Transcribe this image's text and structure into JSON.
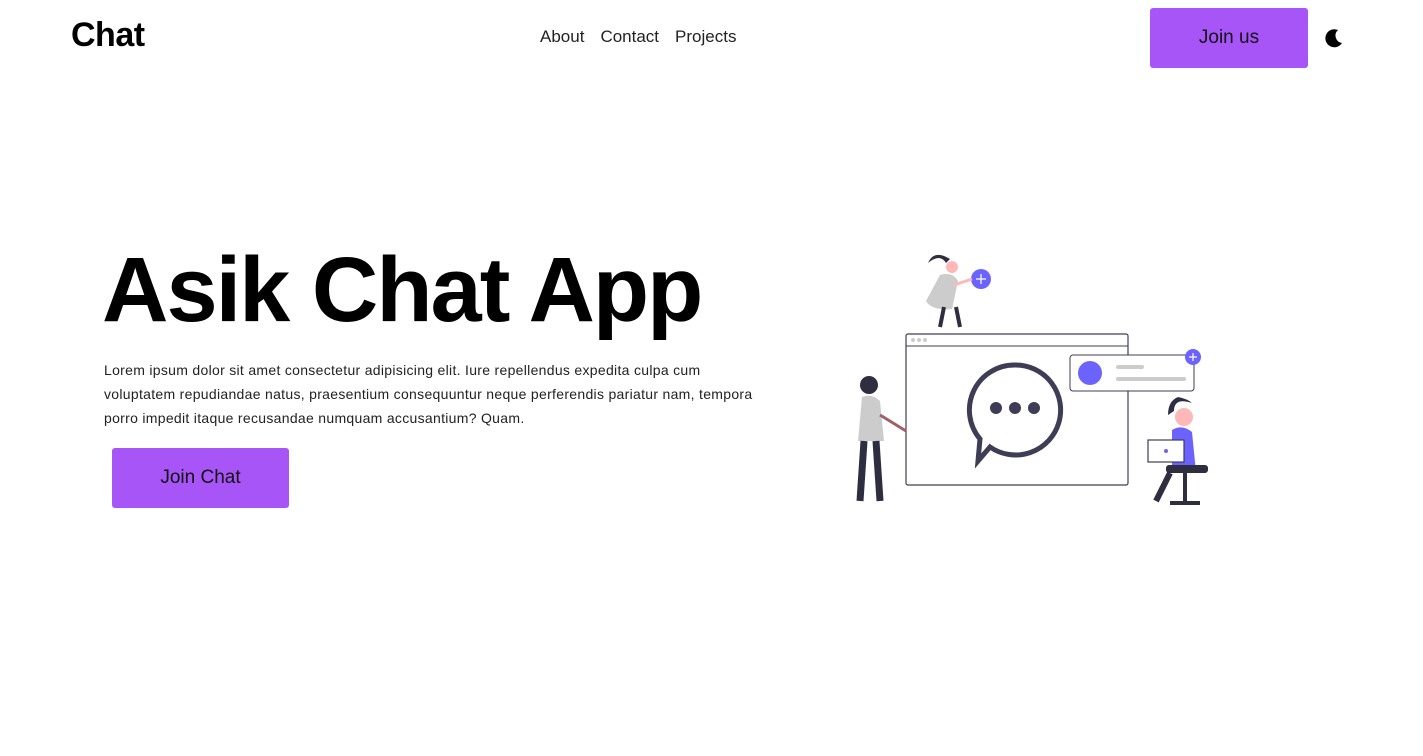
{
  "nav": {
    "logo": "Chat",
    "links": [
      "About",
      "Contact",
      "Projects"
    ],
    "join_label": "Join us",
    "theme_icon": "moon-icon"
  },
  "hero": {
    "title": "Asik Chat App",
    "description": "Lorem ipsum dolor sit amet consectetur adipisicing elit. Iure repellendus expedita culpa cum voluptatem repudiandae natus, praesentium consequuntur neque perferendis pariatur nam, tempora porro impedit itaque recusandae numquam accusantium? Quam.",
    "button_label": "Join Chat",
    "illustration": "chat-illustration"
  },
  "colors": {
    "accent": "#a855f7",
    "illustration_accent": "#6c63ff",
    "dark": "#3f3d56"
  }
}
